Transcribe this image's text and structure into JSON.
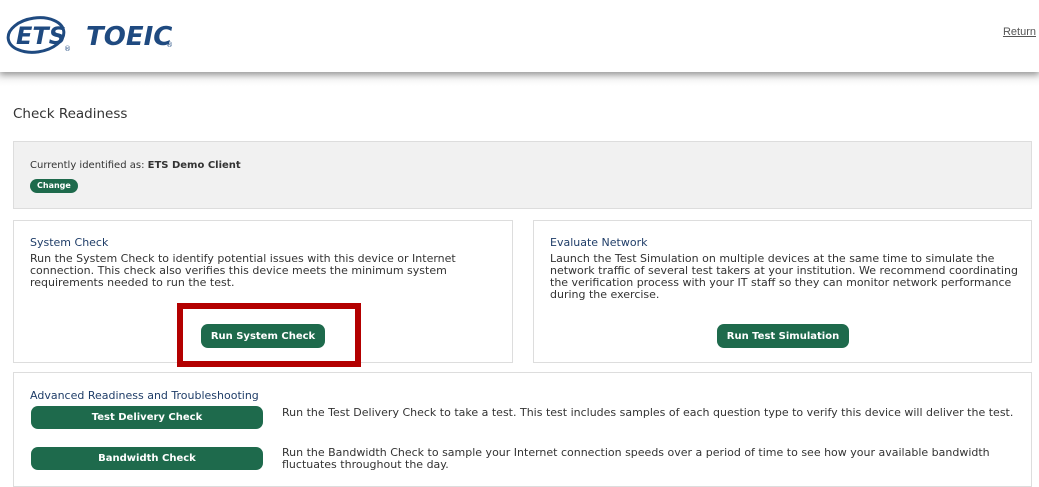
{
  "header": {
    "logo_ets": "ETS",
    "logo_product": "TOEIC",
    "logo_mark": "®",
    "return_label": "Return"
  },
  "page": {
    "title": "Check Readiness"
  },
  "identity": {
    "prefix": "Currently identified as: ",
    "name": "ETS Demo Client",
    "change_label": "Change"
  },
  "system_check": {
    "title": "System Check",
    "description": "Run the System Check to identify potential issues with this device or Internet connection. This check also verifies this device meets the minimum system requirements needed to run the test.",
    "button_label": "Run System Check"
  },
  "network": {
    "title": "Evaluate Network",
    "description": "Launch the Test Simulation on multiple devices at the same time to simulate the network traffic of several test takers at your institution. We recommend coordinating the verification process with your IT staff so they can monitor network performance during the exercise.",
    "button_label": "Run Test Simulation"
  },
  "advanced": {
    "title": "Advanced Readiness and Troubleshooting",
    "items": [
      {
        "button_label": "Test Delivery Check",
        "description": "Run the Test Delivery Check to take a test. This test includes samples of each question type to verify this device will deliver the test."
      },
      {
        "button_label": "Bandwidth Check",
        "description": "Run the Bandwidth Check to sample your Internet connection speeds over a period of time to see how your available bandwidth fluctuates throughout the day."
      }
    ]
  },
  "colors": {
    "brand_blue": "#1f4a80",
    "button_green": "#1e6a4c",
    "highlight_red": "#b30000"
  }
}
